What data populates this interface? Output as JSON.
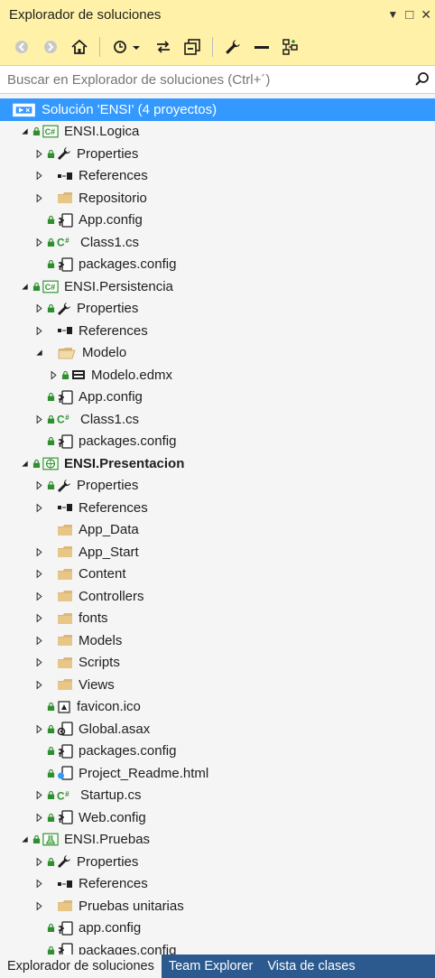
{
  "window": {
    "title": "Explorador de soluciones",
    "pin_glyph": "▼",
    "max_glyph": "□",
    "close_glyph": "✕"
  },
  "search": {
    "placeholder": "Buscar en Explorador de soluciones (Ctrl+´)"
  },
  "tree": {
    "solution": "Solución 'ENSI'  (4 proyectos)",
    "p1": {
      "name": "ENSI.Logica",
      "properties": "Properties",
      "references": "References",
      "repositorio": "Repositorio",
      "appconfig": "App.config",
      "class1": "Class1.cs",
      "packages": "packages.config"
    },
    "p2": {
      "name": "ENSI.Persistencia",
      "properties": "Properties",
      "references": "References",
      "modelo": "Modelo",
      "edmx": "Modelo.edmx",
      "appconfig": "App.config",
      "class1": "Class1.cs",
      "packages": "packages.config"
    },
    "p3": {
      "name": "ENSI.Presentacion",
      "properties": "Properties",
      "references": "References",
      "appdata": "App_Data",
      "appstart": "App_Start",
      "content": "Content",
      "controllers": "Controllers",
      "fonts": "fonts",
      "models": "Models",
      "scripts": "Scripts",
      "views": "Views",
      "favicon": "favicon.ico",
      "global": "Global.asax",
      "packages": "packages.config",
      "readme": "Project_Readme.html",
      "startup": "Startup.cs",
      "webconfig": "Web.config"
    },
    "p4": {
      "name": "ENSI.Pruebas",
      "properties": "Properties",
      "references": "References",
      "pruebas": "Pruebas unitarias",
      "appconfig": "app.config",
      "packages": "packages.config"
    }
  },
  "tabs": {
    "explorer": "Explorador de soluciones",
    "team": "Team Explorer",
    "classview": "Vista de clases"
  },
  "colors": {
    "title_bar": "#fff2a8",
    "selection": "#3399ff",
    "bottom_tabs": "#2c5a8f"
  }
}
